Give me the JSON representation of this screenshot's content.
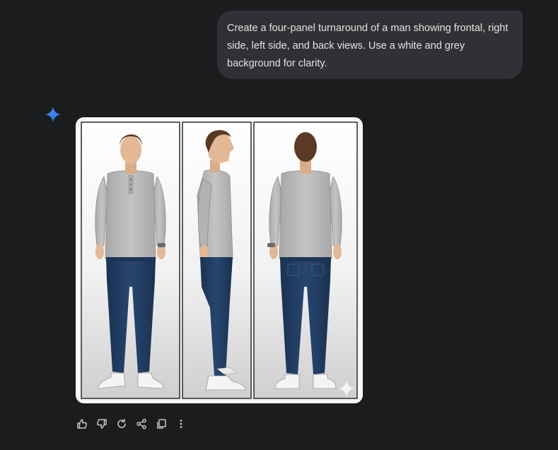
{
  "conversation": {
    "user_message": "Create a four-panel turnaround of a man showing frontal, right side, left side, and back views. Use a white and grey background for clarity."
  },
  "response": {
    "assistant_icon": "gemini-sparkle-icon",
    "image": {
      "watermark_icon": "sparkle-watermark-icon",
      "panels": [
        {
          "view": "front"
        },
        {
          "view": "side"
        },
        {
          "view": "back"
        }
      ]
    },
    "actions": [
      {
        "name": "thumbs-up-icon"
      },
      {
        "name": "thumbs-down-icon"
      },
      {
        "name": "redo-icon"
      },
      {
        "name": "share-icon"
      },
      {
        "name": "copy-icon"
      },
      {
        "name": "more-options-icon"
      }
    ]
  },
  "colors": {
    "background": "#1b1c1d",
    "user_bubble": "#303134",
    "text": "#e3e3e3",
    "icon": "#c4c7c5",
    "gemini_blue": "#4285f4",
    "shirt": "#b9b9b9",
    "jeans": "#1f3a5f",
    "hair": "#5a3a24",
    "skin": "#e2b896"
  }
}
